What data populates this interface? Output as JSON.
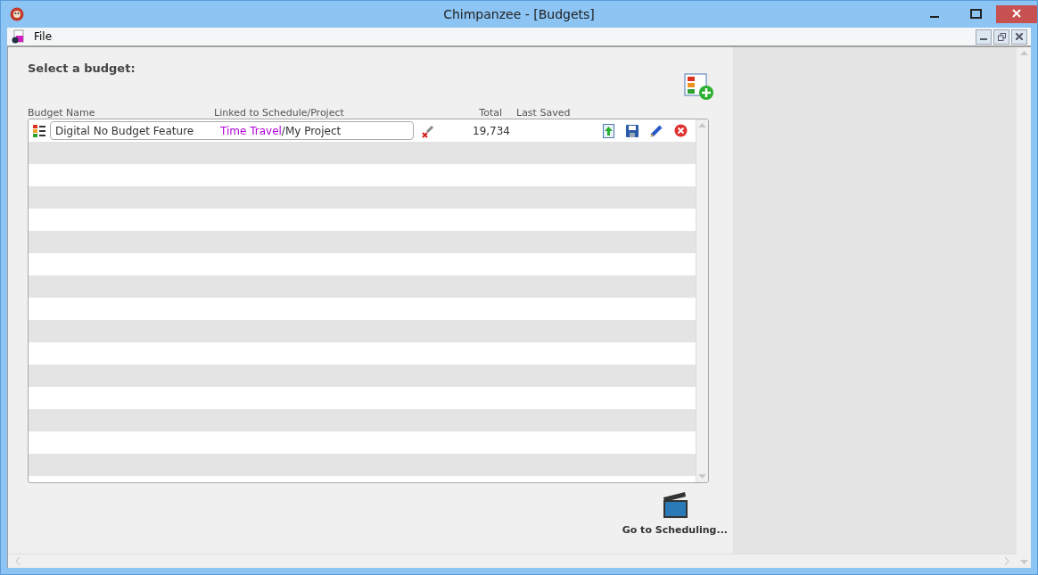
{
  "window": {
    "title": "Chimpanzee - [Budgets]"
  },
  "menu": [
    "File"
  ],
  "heading": "Select a budget:",
  "columns": [
    "Budget Name",
    "Linked to Schedule/Project",
    "Total",
    "Last Saved"
  ],
  "budgets": [
    {
      "name": "Digital No Budget Feature",
      "schedule": "Time Travel",
      "project": "/My Project",
      "total": "19,734",
      "selected": false
    }
  ],
  "go_to_scheduling": "Go to Scheduling..."
}
